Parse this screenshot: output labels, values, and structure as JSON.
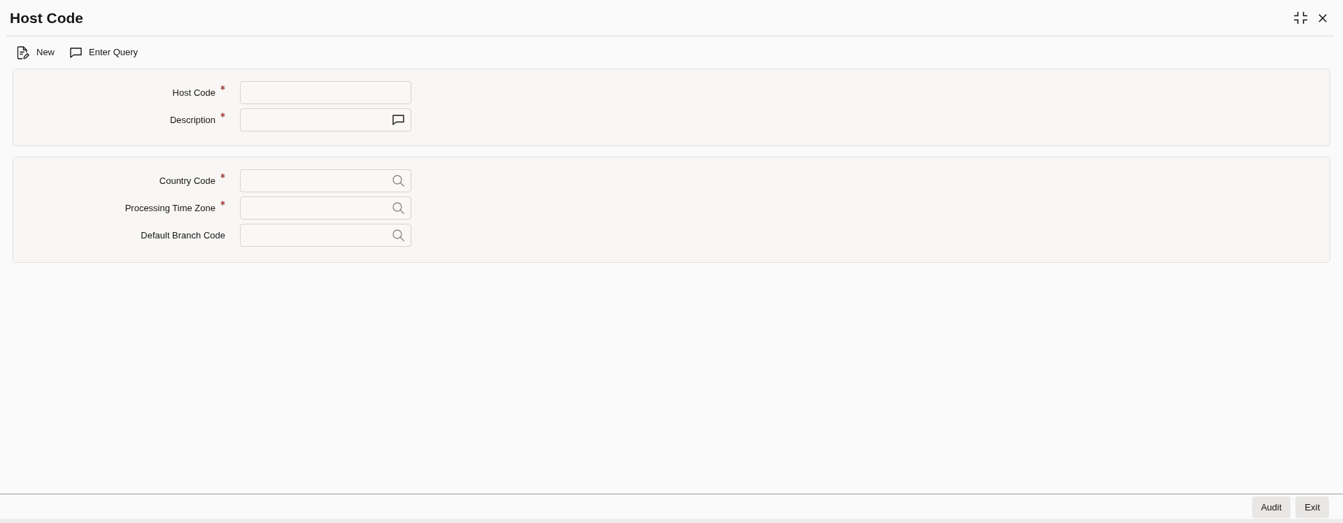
{
  "window": {
    "title": "Host Code"
  },
  "toolbar": [
    {
      "kind": "new",
      "label": "New"
    },
    {
      "kind": "query",
      "label": "Enter Query"
    }
  ],
  "sections": [
    {
      "fields": [
        {
          "label": "Host Code",
          "required": true,
          "kind": "text"
        },
        {
          "label": "Description",
          "required": true,
          "kind": "comment"
        }
      ]
    },
    {
      "fields": [
        {
          "label": "Country Code",
          "required": true,
          "kind": "lookup"
        },
        {
          "label": "Processing Time Zone",
          "required": true,
          "kind": "lookup"
        },
        {
          "label": "Default Branch Code",
          "required": false,
          "kind": "lookup"
        }
      ]
    }
  ],
  "footer_buttons": [
    "Audit",
    "Exit"
  ]
}
